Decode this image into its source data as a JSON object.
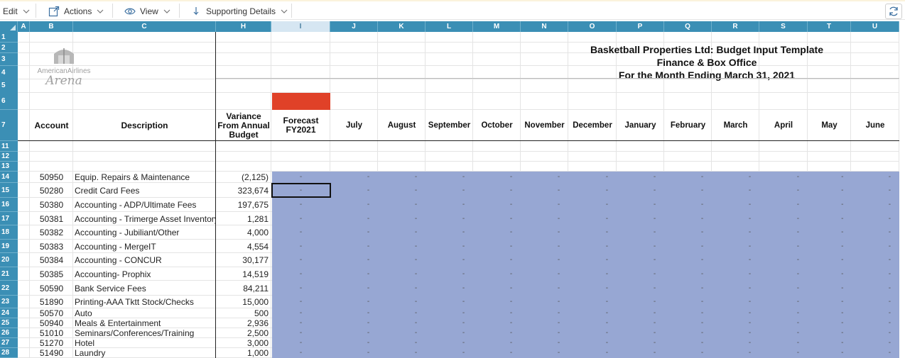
{
  "toolbar": {
    "edit": "Edit",
    "actions": "Actions",
    "view": "View",
    "supporting": "Supporting Details"
  },
  "columns": [
    "A",
    "B",
    "C",
    "H",
    "I",
    "J",
    "K",
    "L",
    "M",
    "N",
    "O",
    "P",
    "Q",
    "R",
    "S",
    "T",
    "U"
  ],
  "rows": [
    "1",
    "2",
    "3",
    "4",
    "5",
    "6",
    "7",
    "11",
    "12",
    "13",
    "14",
    "15",
    "16",
    "17",
    "18",
    "19",
    "20",
    "21",
    "22",
    "23",
    "24",
    "25",
    "26",
    "27",
    "28"
  ],
  "logo": {
    "line1": "AmericanAirlines",
    "line2": "Arena"
  },
  "titles": {
    "line1": "Basketball Properties Ltd: Budget Input Template",
    "line2": "Finance & Box Office",
    "line3": "For the Month Ending March 31, 2021"
  },
  "headers": {
    "account": "Account",
    "description": "Description",
    "variance": [
      "Variance",
      "From Annual",
      "Budget"
    ],
    "forecast": [
      "Forecast",
      "FY2021"
    ],
    "months": [
      "July",
      "August",
      "September",
      "October",
      "November",
      "December",
      "January",
      "February",
      "March",
      "April",
      "May",
      "June"
    ]
  },
  "accounts": [
    {
      "account": "50950",
      "description": "Equip. Repairs & Maintenance",
      "variance": "(2,125)"
    },
    {
      "account": "50280",
      "description": "Credit Card Fees",
      "variance": "323,674"
    },
    {
      "account": "50380",
      "description": "Accounting - ADP/Ultimate Fees",
      "variance": "197,675"
    },
    {
      "account": "50381",
      "description": "Accounting - Trimerge Asset Inventory",
      "variance": "1,281"
    },
    {
      "account": "50382",
      "description": "Accounting - Jubiliant/Other",
      "variance": "4,000"
    },
    {
      "account": "50383",
      "description": "Accounting - MergeIT",
      "variance": "4,554"
    },
    {
      "account": "50384",
      "description": "Accounting - CONCUR",
      "variance": "30,177"
    },
    {
      "account": "50385",
      "description": "Accounting- Prophix",
      "variance": "14,519"
    },
    {
      "account": "50590",
      "description": "Bank Service Fees",
      "variance": "84,211"
    },
    {
      "account": "51890",
      "description": "Printing-AAA Tktt Stock/Checks",
      "variance": "15,000"
    },
    {
      "account": "50570",
      "description": "Auto",
      "variance": "500"
    },
    {
      "account": "50940",
      "description": "Meals & Entertainment",
      "variance": "2,936"
    },
    {
      "account": "51010",
      "description": "Seminars/Conferences/Training",
      "variance": "2,500"
    },
    {
      "account": "51270",
      "description": "Hotel",
      "variance": "3,000"
    },
    {
      "account": "51490",
      "description": "Laundry",
      "variance": "1,000"
    }
  ],
  "empty_value": "-",
  "colors": {
    "header_blue": "#3b8fb5",
    "input_shade": "#97a7d3",
    "forecast_flag": "#e04128"
  }
}
